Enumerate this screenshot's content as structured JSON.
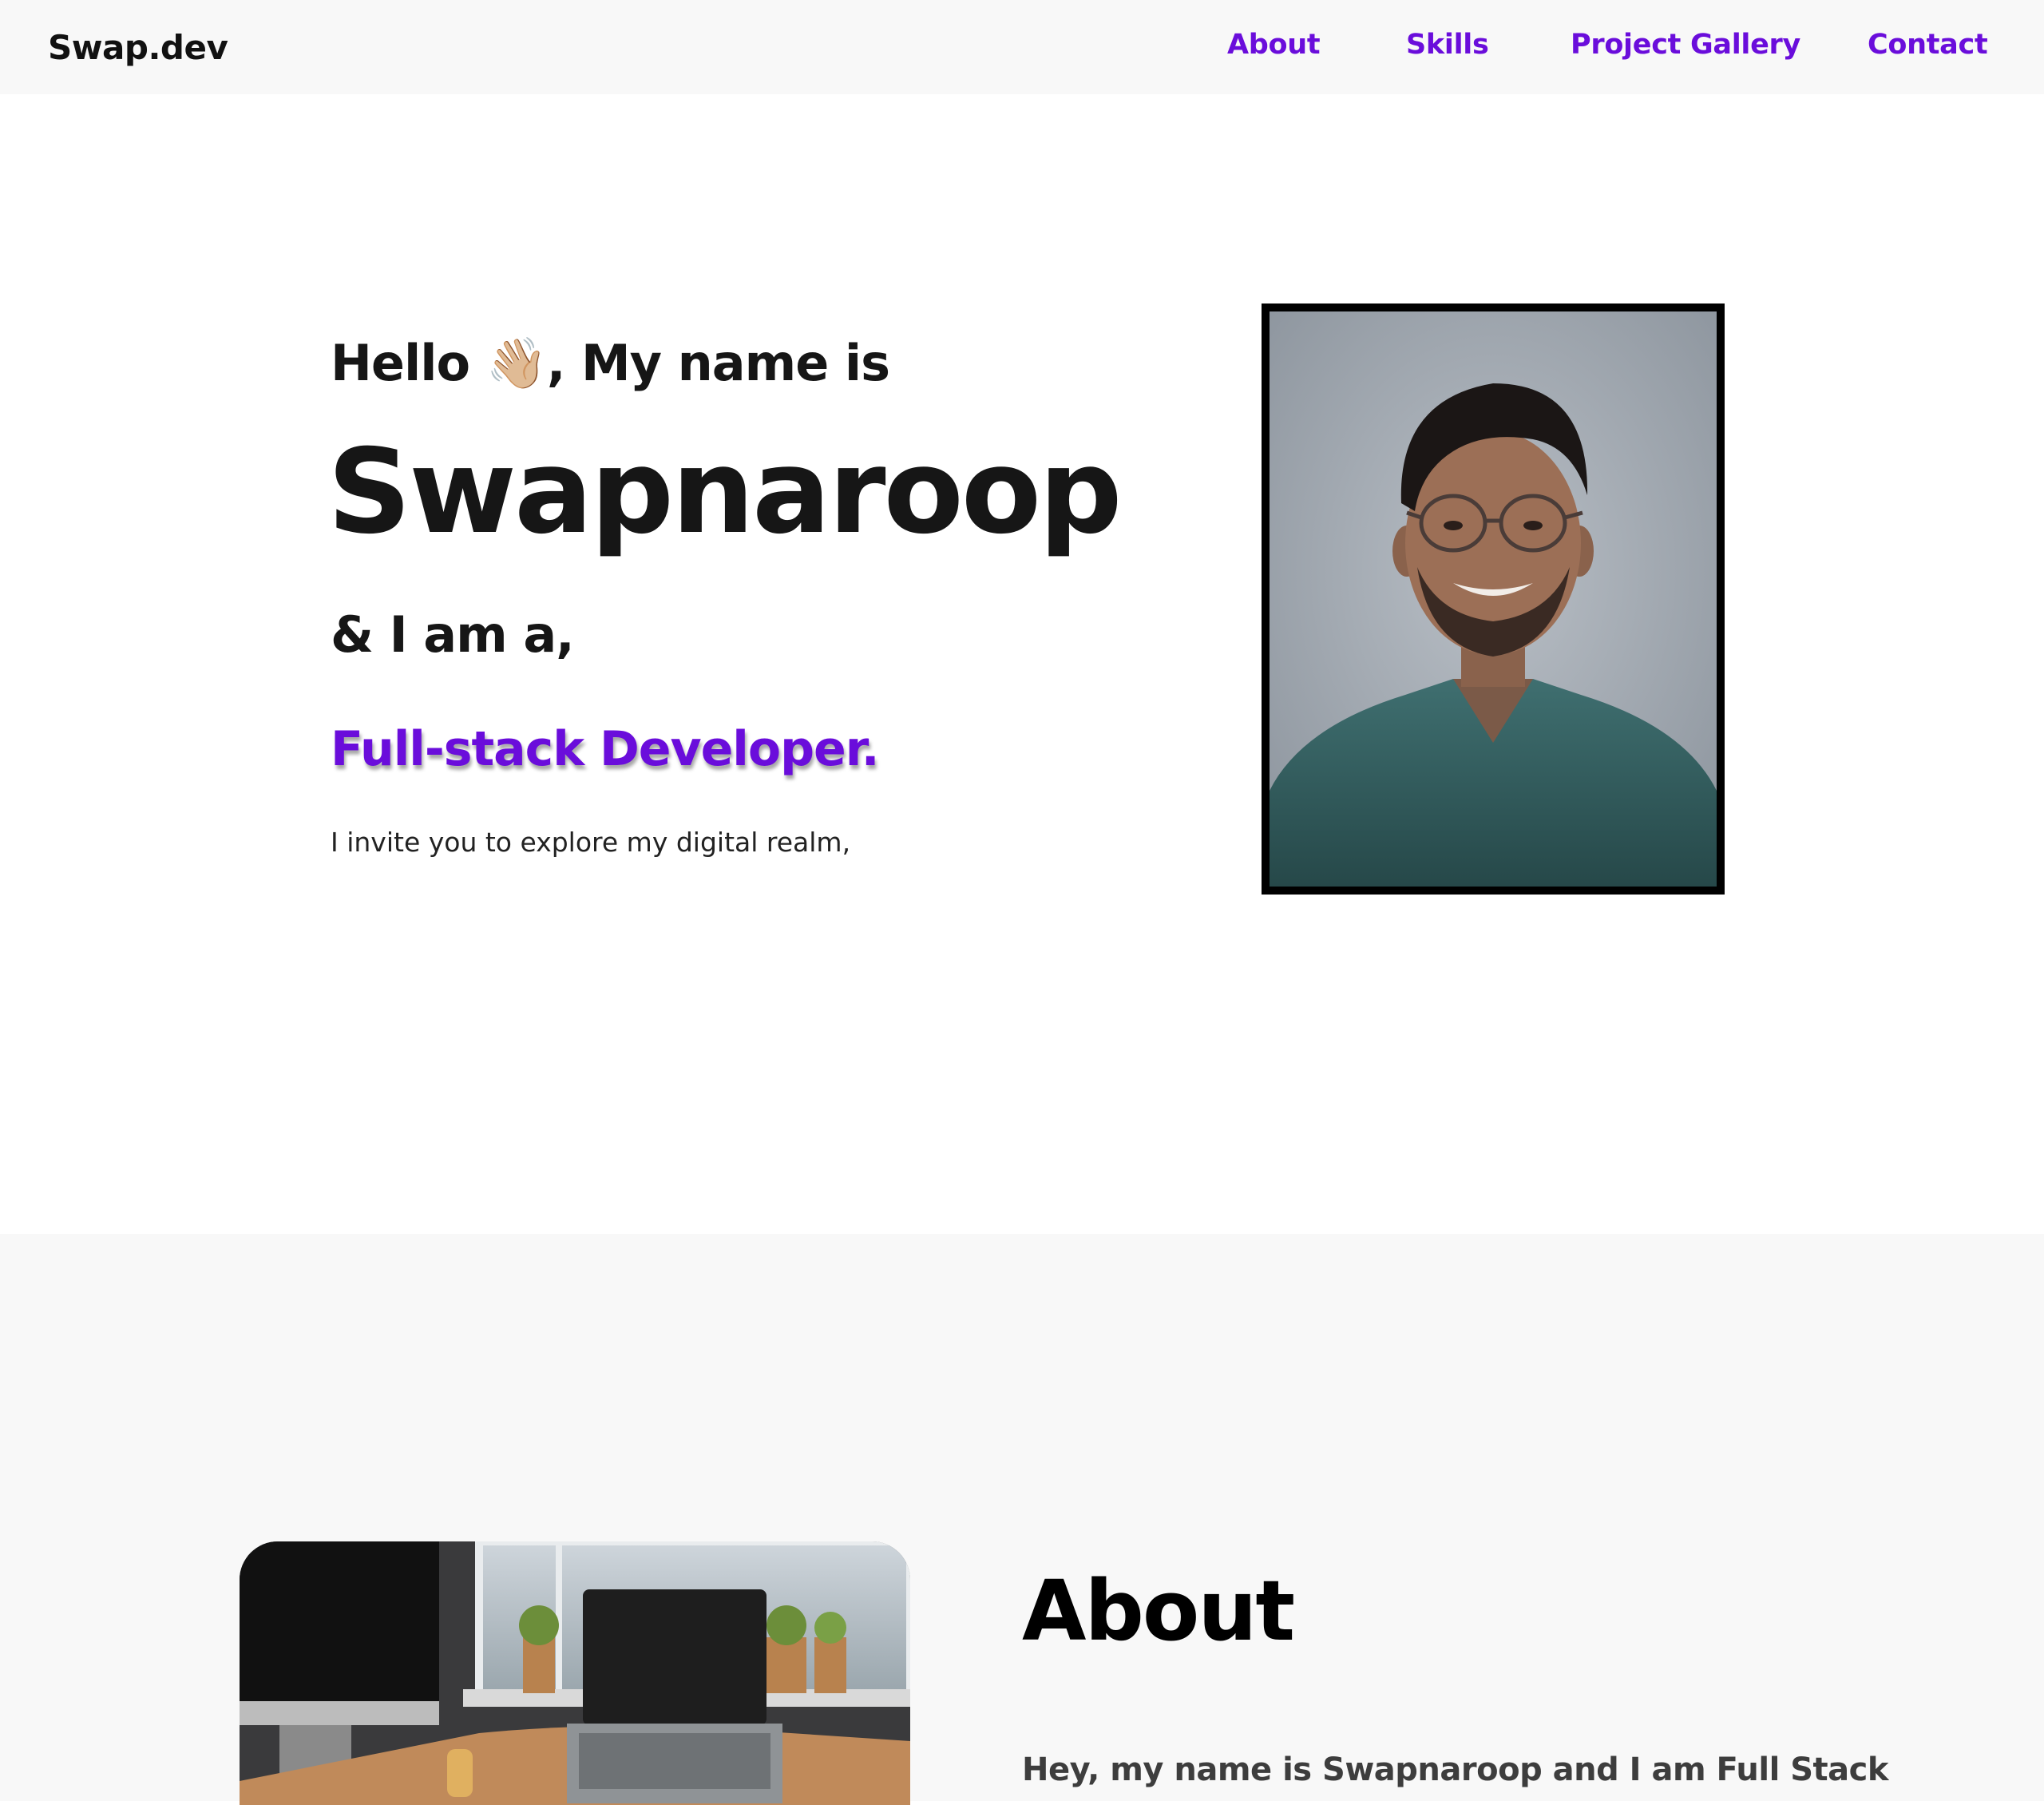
{
  "nav": {
    "brand": "Swap.dev",
    "links": [
      "About",
      "Skills",
      "Project Gallery",
      "Contact"
    ]
  },
  "hero": {
    "greeting_pre": "Hello ",
    "wave_emoji": "👋🏼",
    "greeting_post": ", My name is",
    "name": "Swapnaroop",
    "iam": "& I am a,",
    "role": "Full-stack Developer.",
    "invite": "I invite you to explore my digital realm,"
  },
  "about": {
    "title": "About",
    "text": "Hey, my name is Swapnaroop and I am Full Stack"
  },
  "colors": {
    "accent": "#6a0ddb",
    "text": "#161616",
    "nav_bg": "#f8f8f8",
    "section_bg": "#f8f8f8"
  }
}
